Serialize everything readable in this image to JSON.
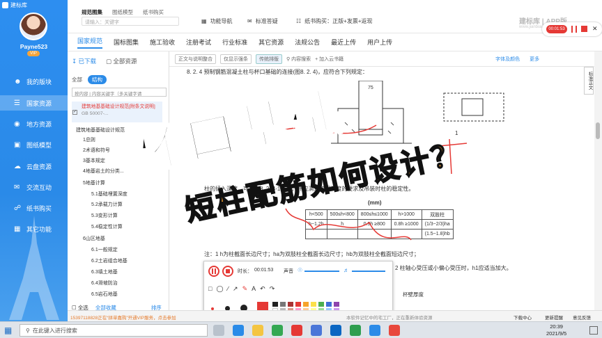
{
  "app": {
    "title": "建标库",
    "user": "Payne523",
    "vip": "VIP"
  },
  "sidebar": {
    "items": [
      {
        "label": "我的版块",
        "icon": "person-icon"
      },
      {
        "label": "国家资源",
        "icon": "layers-icon"
      },
      {
        "label": "地方资源",
        "icon": "map-icon"
      },
      {
        "label": "图纸模型",
        "icon": "image-icon"
      },
      {
        "label": "云盘资源",
        "icon": "cloud-icon"
      },
      {
        "label": "交流互动",
        "icon": "chat-icon"
      },
      {
        "label": "纸书购买",
        "icon": "cart-icon"
      },
      {
        "label": "其它功能",
        "icon": "grid-icon"
      }
    ]
  },
  "topbar": {
    "tabs": [
      "规范图集",
      "图纸模型",
      "纸书购买"
    ],
    "search_placeholder": "请输入：关键字",
    "nav": [
      "功能导航",
      "标准答疑",
      "纸书购买：正版+发票+返现"
    ],
    "brand": "建标库 | APP版",
    "brand_url": "www.jianbiaoku.com",
    "rec_time": "00:01:53"
  },
  "menubar": [
    "国家规范",
    "国标图集",
    "施工验收",
    "注册考试",
    "行业标准",
    "其它资源",
    "法规公告",
    "最近上传",
    "用户上传"
  ],
  "leftpanel": {
    "btn_downloaded": "已下载",
    "btn_all": "全部资源",
    "pill_all": "全部",
    "pill_struct": "结构",
    "filter": "按内容",
    "filter_ph": "内容关键字（多关键字请",
    "selected": "建筑地基基础设计规范[附条文说明]",
    "selected_code": "GB 50007-...",
    "tree": [
      "建筑地基基础设计规范",
      "1总则",
      "2术语和符号",
      "3基本规定",
      "4地基岩土的分类...",
      "5地基计算",
      "5.1基础埋置深度",
      "5.2承载力计算",
      "5.3变形计算",
      "5.4稳定性计算",
      "6山区地基",
      "6.1一般规定",
      "6.2土岩组合地基",
      "6.3填土地基",
      "6.4滑坡防治",
      "6.5岩石地基"
    ],
    "select_all": "全选",
    "cancel_fav": "全部收藏",
    "sort": "排序"
  },
  "doc": {
    "toolbar": [
      "正文与说明整合",
      "仅显示强条",
      "传统排版",
      "内容搜索",
      "加入云书籍"
    ],
    "font_color": "字体及颜色",
    "more": "更多",
    "heading": "8. 2. 4   预制钢筋混凝土柱与杯口基础的连接(图8. 2. 4)，应符合下列规定：",
    "p1": "柱的插入深度，可按表8. 2. 4-1选用，并应满足锚固长度的要求及吊装时柱的稳定性。",
    "p2": "注：1  h为柱截面长边尺寸；ha为双肢柱全截面长边尺寸；hb为双肢柱全截面短边尺寸；",
    "p3": "2  柱轴心受压或小偏心受压时，h1应适当加大。",
    "table_title": "(mm)",
    "fig_label": "1",
    "table_head": [
      "h<500",
      "500≤h<800",
      "800≤h≤1000",
      "h>1000",
      "双肢柱"
    ],
    "table_row1": [
      "h~1.2h",
      "h",
      "0.9h ≥800",
      "0.8h ≥1000",
      "(1/3~2/3)ha"
    ],
    "table_row2": [
      "",
      "",
      "",
      "",
      "(1.5~1.8)hb"
    ],
    "side_tab": "标准正文",
    "toc_hint": "杯壁厚度"
  },
  "overlay": {
    "title": "杯口基础",
    "subtitle": "短柱配筋如何设计？"
  },
  "recorder": {
    "time_label": "时长：",
    "time": "00:01:53",
    "vol_label": "声音"
  },
  "status": {
    "left": "15397118828正在“拼单嘉购”开通VIP服务，点击参加",
    "mid": "本软件记忆中的宅工厂，正在重新体验资源",
    "dl": "下载中心",
    "update": "更新提醒",
    "feedback": "意见反馈"
  },
  "taskbar": {
    "search": "在此键入进行搜索",
    "time": "20:39",
    "date": "2021/9/5"
  },
  "colors": {
    "accent": "#2b8be8",
    "title_orange": "#e9962b",
    "rec_red": "#e53935"
  }
}
